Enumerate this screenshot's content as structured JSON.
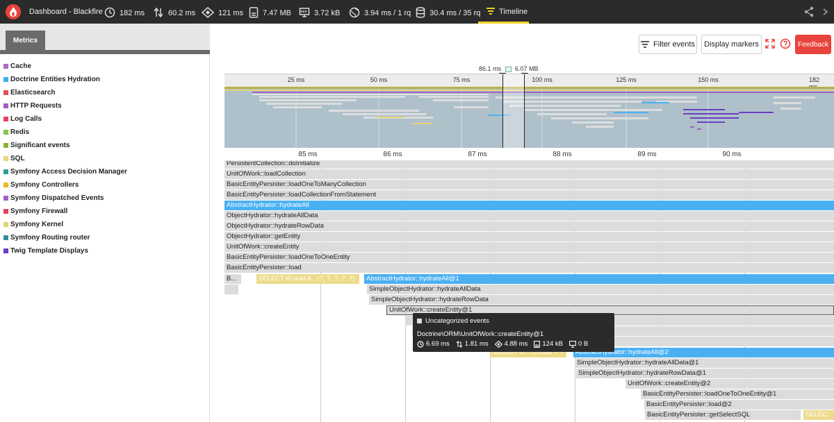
{
  "header": {
    "title": "Dashboard - Blackfire",
    "metrics": [
      {
        "icon": "clock-icon",
        "value": "182 ms"
      },
      {
        "icon": "updown-arrows-icon",
        "value": "60.2 ms"
      },
      {
        "icon": "cpu-icon",
        "value": "121 ms"
      },
      {
        "icon": "memory-icon",
        "value": "7.47 MB"
      },
      {
        "icon": "network-icon",
        "value": "3.72 kB"
      },
      {
        "icon": "globe-icon",
        "value": "3.94 ms / 1 rq"
      },
      {
        "icon": "database-icon",
        "value": "30.4 ms / 35 rq"
      }
    ],
    "active_tab": "Timeline"
  },
  "sidebar": {
    "tab_label": "Metrics",
    "items": [
      {
        "label": "Cache",
        "color": "#b06bc2"
      },
      {
        "label": "Doctrine Entities Hydration",
        "color": "#3bb2e8"
      },
      {
        "label": "Elasticsearch",
        "color": "#e04e5b"
      },
      {
        "label": "HTTP Requests",
        "color": "#a35ec4"
      },
      {
        "label": "Log Calls",
        "color": "#e2455d"
      },
      {
        "label": "Redis",
        "color": "#8bc34a"
      },
      {
        "label": "Significant events",
        "color": "#8ab42b"
      },
      {
        "label": "SQL",
        "color": "#e8d37a"
      },
      {
        "label": "Symfony Access Decision Manager",
        "color": "#2e9e97"
      },
      {
        "label": "Symfony Controllers",
        "color": "#e8b923"
      },
      {
        "label": "Symfony Dispatched Events",
        "color": "#a062c0"
      },
      {
        "label": "Symfony Firewall",
        "color": "#e2455d"
      },
      {
        "label": "Symfony Kernel",
        "color": "#e2d375"
      },
      {
        "label": "Symfony Routing router",
        "color": "#2f8f9a"
      },
      {
        "label": "Twig Template Displays",
        "color": "#6a3fc2"
      }
    ]
  },
  "toolbar": {
    "filter_label": "Filter events",
    "markers_label": "Display markers",
    "feedback_label": "Feedback"
  },
  "overview": {
    "ticks": [
      "25 ms",
      "50 ms",
      "75 ms",
      "100 ms",
      "125 ms",
      "150 ms",
      "182 ms"
    ],
    "marker_time": "86.1 ms",
    "marker_memory": "6.07 MB"
  },
  "zoom_ticks": [
    "85 ms",
    "86 ms",
    "87 ms",
    "88 ms",
    "89 ms",
    "90 ms"
  ],
  "rows": {
    "r1": "PersistentCollection::doInitialize",
    "r2": "UnitOfWork::loadCollection",
    "r3": "BasicEntityPersister::loadOneToManyCollection",
    "r4": "BasicEntityPersister::loadCollectionFromStatement",
    "r5": "AbstractHydrator::hydrateAll",
    "r6": "ObjectHydrator::hydrateAllData",
    "r7": "ObjectHydrator::hydrateRowData",
    "r8": "ObjectHydrator::getEntity",
    "r9": "UnitOfWork::createEntity",
    "r10": "BasicEntityPersister::loadOneToOneEntity",
    "r11": "BasicEntityPersister::load",
    "r12a": "B...",
    "r12b": "SELECT t0.uuid A...(?, ?, ?, ?, ?)",
    "r12c": "AbstractHydrator::hydrateAll@1",
    "r13": "SimpleObjectHydrator::hydrateAllData",
    "r14": "SimpleObjectHydrator::hydrateRowData",
    "r15": "UnitOfWork::createEntity@1",
    "r19a": "SELECT t0.....0.uuid = ?",
    "r19b": "AbstractHydrator::hydrateAll@2",
    "r20": "SimpleObjectHydrator::hydrateAllData@1",
    "r21": "SimpleObjectHydrator::hydrateRowData@1",
    "r22": "UnitOfWork::createEntity@2",
    "r23": "BasicEntityPersister::loadOneToOneEntity@1",
    "r24": "BasicEntityPersister::load@2",
    "r25a": "BasicEntityPersister::getSelectSQL",
    "r25b": "SELEC"
  },
  "tooltip": {
    "category": "Uncategorized events",
    "name": "Doctrine\\ORM\\UnitOfWork::createEntity@1",
    "wall": "6.69 ms",
    "io": "1.81 ms",
    "cpu": "4.88 ms",
    "memory": "124 kB",
    "peak": "0 B"
  },
  "colors": {
    "accent": "#e8433d",
    "hydration_blue": "#4ab0f2",
    "sql_yellow": "#eddb8a",
    "active_tab_underline": "#f0d327"
  }
}
